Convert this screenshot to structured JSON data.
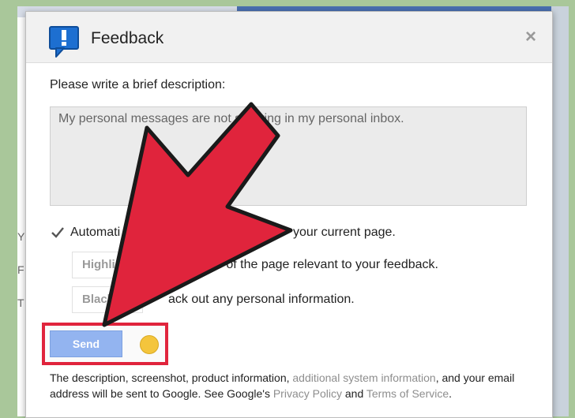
{
  "dialog": {
    "title": "Feedback",
    "close_glyph": "×",
    "icon": "feedback-exclamation-icon"
  },
  "form": {
    "prompt": "Please write a brief description:",
    "description_value": "My personal messages are not showing in my personal inbox.",
    "auto_label_start": "Automati",
    "auto_label_end": "your current page.",
    "highlight_button": "Highli",
    "highlight_desc": "as of the page relevant to your feedback.",
    "blackout_button": "Black",
    "blackout_desc": "ack out any personal information.",
    "send_label": "Send"
  },
  "footer": {
    "part1": "The description, screenshot, product information, ",
    "link_system": "additional system information",
    "part2": ", and your email address will be sent to Google. See Google's ",
    "link_privacy": "Privacy Policy",
    "part3": " and ",
    "link_terms": "Terms of Service",
    "part4": "."
  },
  "background": {
    "left_letters": [
      "Y",
      "F",
      "T"
    ]
  },
  "colors": {
    "highlight_red": "#e0243c",
    "send_blue": "#93b4f0",
    "header_bg": "#f1f1f1"
  }
}
